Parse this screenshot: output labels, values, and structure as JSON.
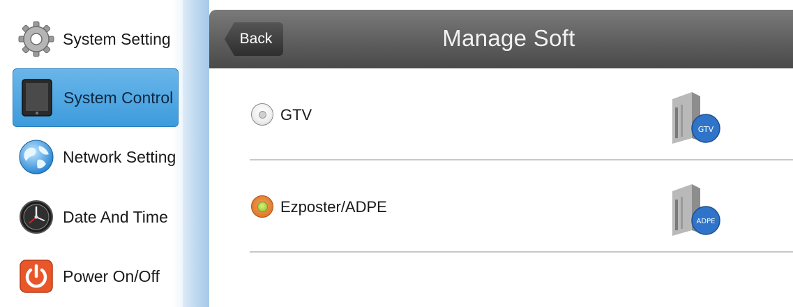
{
  "sidebar": {
    "items": [
      {
        "label": "System Setting",
        "icon": "gear-icon",
        "active": false
      },
      {
        "label": "System Control",
        "icon": "tablet-icon",
        "active": true
      },
      {
        "label": "Network Setting",
        "icon": "globe-icon",
        "active": false
      },
      {
        "label": "Date And Time",
        "icon": "clock-icon",
        "active": false
      },
      {
        "label": "Power On/Off",
        "icon": "power-icon",
        "active": false
      }
    ]
  },
  "header": {
    "back_label": "Back",
    "title": "Manage Soft"
  },
  "options": [
    {
      "label": "GTV",
      "selected": false,
      "badge": "GTV",
      "icon": "server-gtv-icon"
    },
    {
      "label": "Ezposter/ADPE",
      "selected": true,
      "badge": "ADPE",
      "icon": "server-adpe-icon"
    }
  ],
  "colors": {
    "active_item": "#3d9bdc",
    "titlebar": "#5e5e5e",
    "radio_selected": "#e07a2e"
  }
}
